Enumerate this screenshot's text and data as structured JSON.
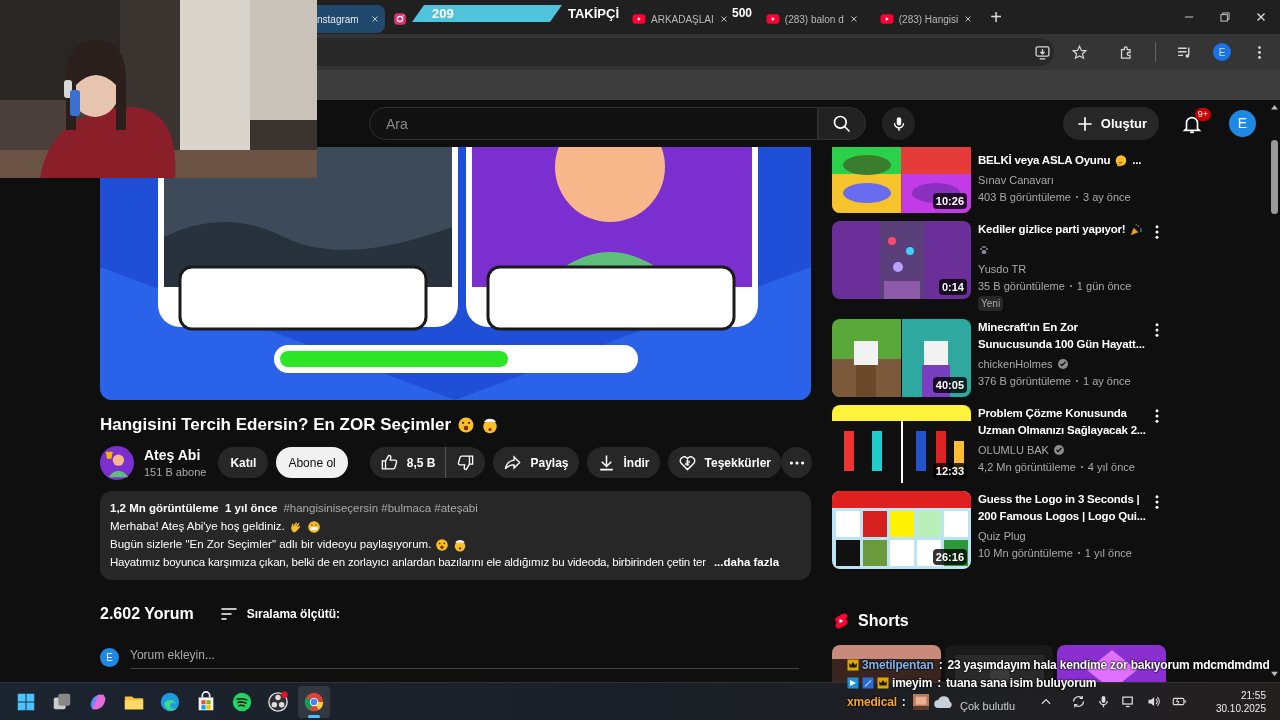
{
  "browser": {
    "tabs": [
      {
        "kind": "instagram",
        "title": "nstagram",
        "selected": true,
        "closable": true
      },
      {
        "kind": "instagram",
        "selected": false,
        "closable": false
      },
      {
        "kind": "youtube",
        "title": "ARKADAŞLAI",
        "selected": false,
        "closable": true
      },
      {
        "kind": "youtube",
        "title": "(283) balon d",
        "selected": false,
        "closable": true
      },
      {
        "kind": "youtube",
        "title": "(283) Hangisi",
        "selected": false,
        "closable": true
      }
    ],
    "new_tab": "+",
    "profile": "E"
  },
  "follower_goal": {
    "current": "209",
    "label": "TAKİPÇİ",
    "target": "500"
  },
  "header": {
    "search_placeholder": "Ara",
    "create": "Oluştur",
    "notifications": "9+",
    "avatar": "E"
  },
  "video": {
    "title": "Hangisini Tercih Edersin? En ZOR Seçimler",
    "title_emojis": [
      {
        "kind": "surprised"
      },
      {
        "kind": "mindblown"
      }
    ],
    "channel": "Ateş Abi",
    "subscribers": "151 B abone",
    "join": "Katıl",
    "subscribe": "Abone ol",
    "likes": "8,5 B",
    "share": "Paylaş",
    "download": "İndir",
    "thanks": "Teşekkürler",
    "description": {
      "stats": "1,2 Mn görüntüleme  1 yıl önce",
      "hashtags": "#hangisiniseçersin #bulmaca #ateşabi",
      "lines": [
        {
          "text": "Merhaba! Ateş Abi'ye hoş geldiniz.",
          "emojis": [
            {
              "kind": "wave"
            },
            {
              "kind": "grin"
            }
          ]
        },
        {
          "text": "Bugün sizlerle \"En Zor Seçimler\" adlı bir videoyu paylaşıyorum.",
          "emojis": [
            {
              "kind": "surprised"
            },
            {
              "kind": "mindblown"
            }
          ]
        },
        {
          "text": "Hayatımız boyunca karşımıza çıkan, belki de en zorlayıcı anlardan bazılarını ele aldığımız bu videoda, birbirinden çetin ter"
        }
      ],
      "more": "...daha fazla"
    }
  },
  "comments": {
    "count": "2.602 Yorum",
    "sort": "Sıralama ölçütü:",
    "avatar": "E",
    "placeholder": "Yorum ekleyin..."
  },
  "recommendations": [
    {
      "title": "BELKİ veya ASLA Oyunu",
      "title_emojis": [
        {
          "kind": "thinking"
        }
      ],
      "title_end": "...",
      "channel": "Sınav Canavarı",
      "verified": false,
      "views": "403 B görüntüleme",
      "age": "3 ay önce",
      "duration": "10:26",
      "cut_top": true
    },
    {
      "title": "Kediler gizlice parti yapıyor!",
      "title_emojis": [
        {
          "kind": "party"
        }
      ],
      "second_line_emojis": [
        {
          "kind": "paw"
        }
      ],
      "channel": "Yusdo TR",
      "verified": false,
      "views": "35 B görüntüleme",
      "age": "1 gün önce",
      "duration": "0:14",
      "badge": "Yeni",
      "cut_top": false
    },
    {
      "title": "Minecraft'ın En Zor Sunucusunda 100 Gün Hayatt...",
      "channel": "chickenHolmes",
      "verified": true,
      "views": "376 B görüntüleme",
      "age": "1 ay önce",
      "duration": "40:05",
      "cut_top": false
    },
    {
      "title": "Problem Çözme Konusunda Uzman Olmanızı Sağlayacak 2...",
      "channel": "OLUMLU BAK",
      "verified": true,
      "views": "4,2 Mn görüntüleme",
      "age": "4 yıl önce",
      "duration": "12:33",
      "cut_top": false
    },
    {
      "title": "Guess the Logo in 3 Seconds | 200 Famous Logos | Logo Qui...",
      "channel": "Quiz Plug",
      "verified": false,
      "views": "10 Mn görüntüleme",
      "age": "1 yıl önce",
      "duration": "26:16",
      "cut_top": false
    }
  ],
  "shorts": {
    "heading": "Shorts"
  },
  "chat": [
    {
      "user": "3metilpentan",
      "color": "#7fb2e5",
      "separator": ":",
      "text": "23 yaşımdayım hala kendime zor bakıyorum mdcmdmdmd",
      "badges": [
        {
          "kind": "crown"
        }
      ]
    },
    {
      "user": "imeyim",
      "color": "#ffffff",
      "separator": ":",
      "text": "tuana sana isim buluyorum",
      "badges": [
        {
          "kind": "prime"
        },
        {
          "kind": "sword"
        },
        {
          "kind": "crown"
        }
      ]
    },
    {
      "user": "xmedical",
      "color": "#f5a623",
      "separator": ":",
      "emote": true
    }
  ],
  "taskbar": {
    "apps": [
      {
        "kind": "start",
        "active": false
      },
      {
        "kind": "taskview",
        "active": false
      },
      {
        "kind": "copilot",
        "active": false
      },
      {
        "kind": "explorer",
        "active": false
      },
      {
        "kind": "edge",
        "active": false
      },
      {
        "kind": "store",
        "active": false
      },
      {
        "kind": "spotify",
        "active": false
      },
      {
        "kind": "obs",
        "active": false
      },
      {
        "kind": "chrome",
        "active": true
      }
    ],
    "weather": "Çok bulutlu",
    "time": "21:55",
    "date": "30.10.2025"
  }
}
